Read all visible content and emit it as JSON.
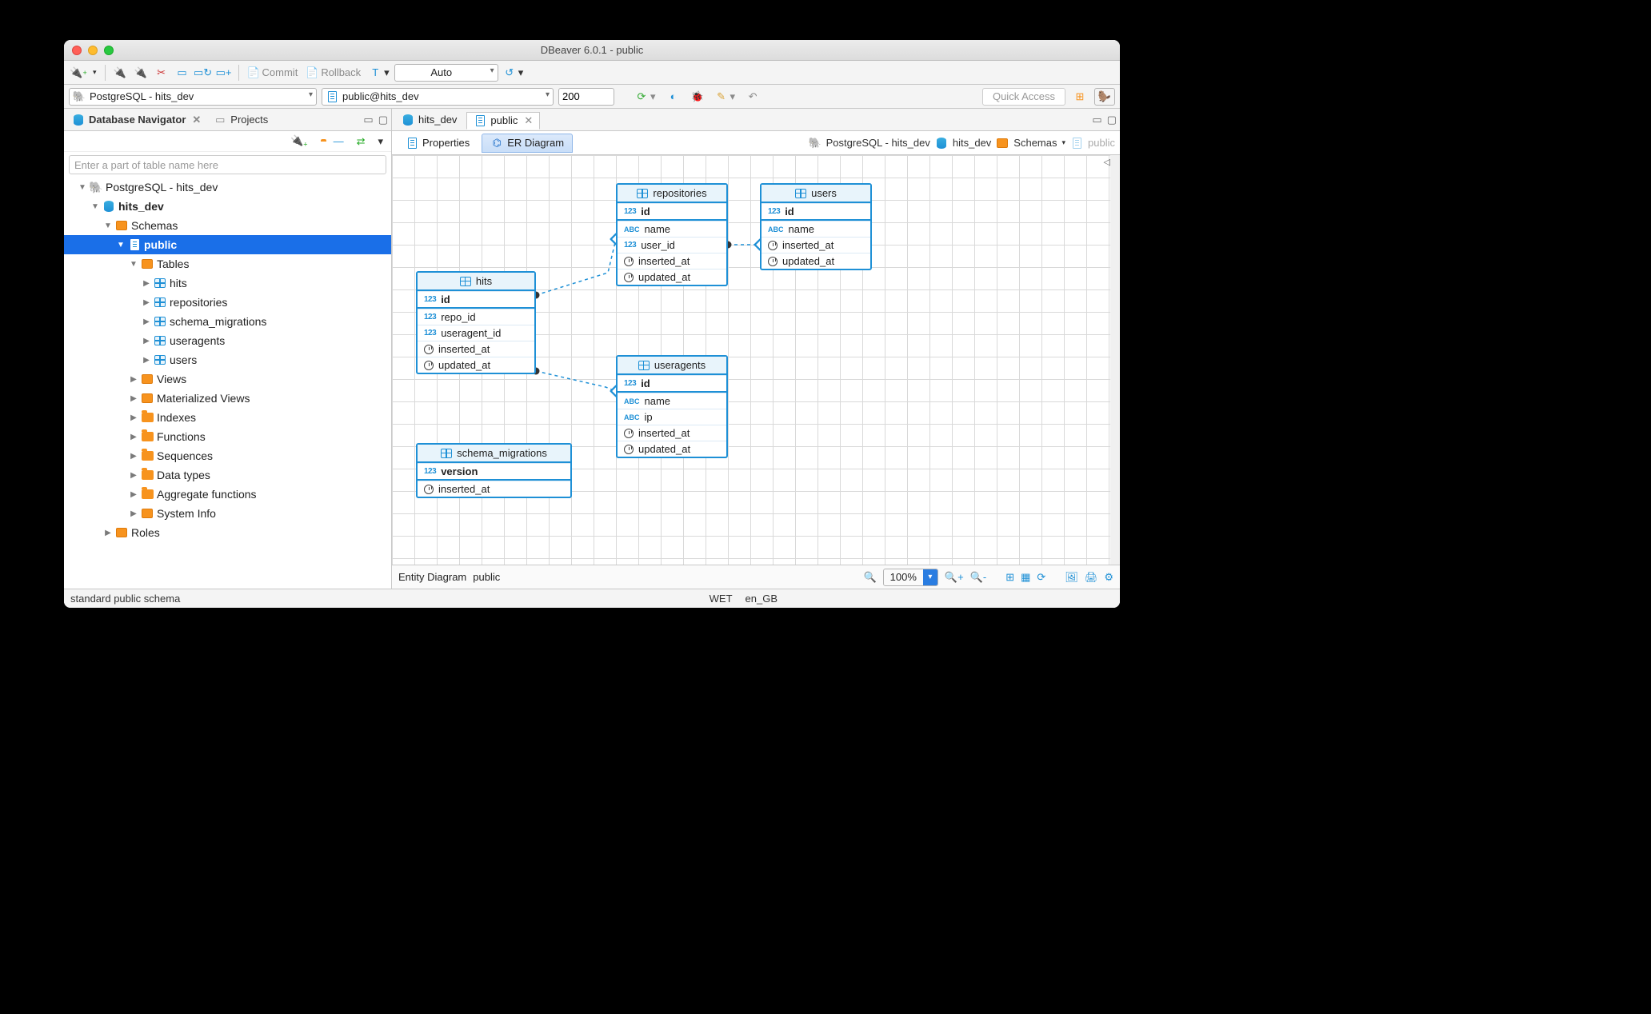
{
  "window_title": "DBeaver 6.0.1 - public",
  "toolbar1": {
    "commit": "Commit",
    "rollback": "Rollback",
    "mode": "Auto"
  },
  "toolbar2": {
    "datasource": "PostgreSQL - hits_dev",
    "catalog": "public@hits_dev",
    "limit": "200",
    "quick_access": "Quick Access"
  },
  "left": {
    "tab_navigator": "Database Navigator",
    "tab_projects": "Projects",
    "filter_placeholder": "Enter a part of table name here",
    "tree": {
      "conn": "PostgreSQL - hits_dev",
      "db": "hits_dev",
      "schemas": "Schemas",
      "public": "public",
      "tables": "Tables",
      "t_hits": "hits",
      "t_repositories": "repositories",
      "t_schema_migrations": "schema_migrations",
      "t_useragents": "useragents",
      "t_users": "users",
      "views": "Views",
      "mviews": "Materialized Views",
      "indexes": "Indexes",
      "functions": "Functions",
      "sequences": "Sequences",
      "datatypes": "Data types",
      "aggfns": "Aggregate functions",
      "sysinfo": "System Info",
      "roles": "Roles"
    }
  },
  "right": {
    "tab_db": "hits_dev",
    "tab_schema": "public",
    "subtab_properties": "Properties",
    "subtab_er": "ER Diagram",
    "breadcrumb": {
      "conn_icon": "postgres",
      "conn": "PostgreSQL - hits_dev",
      "db": "hits_dev",
      "schemas": "Schemas",
      "public": "public"
    },
    "entities": {
      "hits": {
        "title": "hits",
        "cols": [
          "id",
          "repo_id",
          "useragent_id",
          "inserted_at",
          "updated_at"
        ]
      },
      "schema_migrations": {
        "title": "schema_migrations",
        "cols": [
          "version",
          "inserted_at"
        ]
      },
      "repositories": {
        "title": "repositories",
        "cols": [
          "id",
          "name",
          "user_id",
          "inserted_at",
          "updated_at"
        ]
      },
      "useragents": {
        "title": "useragents",
        "cols": [
          "id",
          "name",
          "ip",
          "inserted_at",
          "updated_at"
        ]
      },
      "users": {
        "title": "users",
        "cols": [
          "id",
          "name",
          "inserted_at",
          "updated_at"
        ]
      }
    },
    "status": {
      "label": "Entity Diagram",
      "schema": "public",
      "zoom": "100%"
    }
  },
  "footer": {
    "desc": "standard public schema",
    "tz": "WET",
    "locale": "en_GB"
  }
}
